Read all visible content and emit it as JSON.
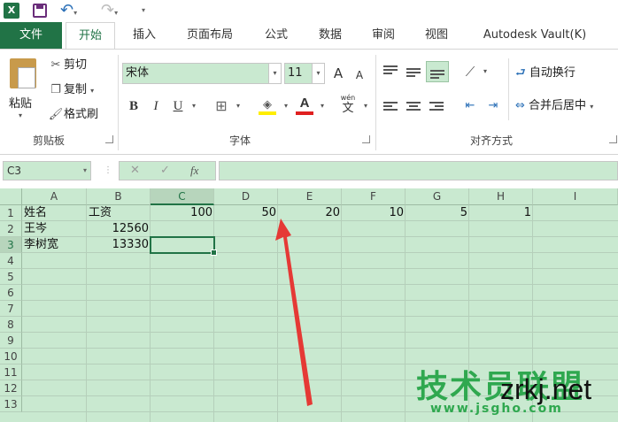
{
  "qat": {
    "app_icon": "X",
    "save_icon": "save-icon",
    "undo_icon": "undo-icon",
    "redo_icon": "redo-icon"
  },
  "tabs": [
    "文件",
    "开始",
    "插入",
    "页面布局",
    "公式",
    "数据",
    "审阅",
    "视图",
    "Autodesk Vault(K)"
  ],
  "clipboard": {
    "paste": "粘贴",
    "cut": "剪切",
    "copy": "复制",
    "format_painter": "格式刷",
    "group": "剪贴板"
  },
  "font": {
    "name": "宋体",
    "size": "11",
    "group": "字体",
    "bold": "B",
    "italic": "I",
    "underline": "U",
    "grow": "A",
    "shrink": "A",
    "phonetic": "wén"
  },
  "alignment": {
    "wrap": "自动换行",
    "merge": "合并后居中",
    "group": "对齐方式"
  },
  "formula_bar": {
    "name_box": "C3",
    "fx": "fx",
    "formula": ""
  },
  "columns": [
    "A",
    "B",
    "C",
    "D",
    "E",
    "F",
    "G",
    "H",
    "I"
  ],
  "rows": [
    "1",
    "2",
    "3",
    "4",
    "5",
    "6",
    "7",
    "8",
    "9",
    "10",
    "11",
    "12",
    "13"
  ],
  "cells": {
    "A1": "姓名",
    "B1": "工资",
    "C1": "100",
    "D1": "50",
    "E1": "20",
    "F1": "10",
    "G1": "5",
    "H1": "1",
    "A2": "王岑",
    "B2": "12560",
    "A3": "李树宽",
    "B3": "13330"
  },
  "watermark": {
    "title": "技术员联盟",
    "url": "www.jsgho.com",
    "site": "zrkj.net"
  },
  "colors": {
    "accent": "#217346",
    "grid_bg": "#c9e9d0",
    "arrow": "#e53935"
  }
}
